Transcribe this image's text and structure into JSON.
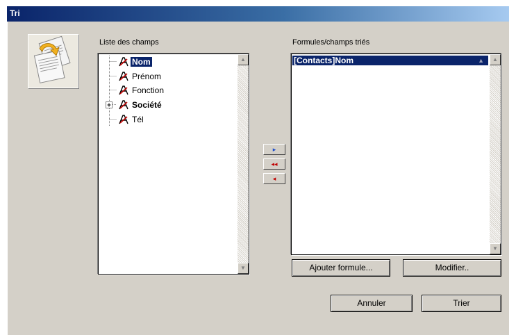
{
  "window": {
    "title": "Tri"
  },
  "icons": {
    "app": "sort-documents-icon",
    "field": "field-a-icon"
  },
  "left_panel": {
    "label": "Liste des champs",
    "items": [
      {
        "label": "Nom",
        "selected": true,
        "bold": true
      },
      {
        "label": "Prénom",
        "selected": false,
        "bold": false
      },
      {
        "label": "Fonction",
        "selected": false,
        "bold": false
      },
      {
        "label": "Société",
        "selected": false,
        "bold": true,
        "expandable": true
      },
      {
        "label": "Tél",
        "selected": false,
        "bold": false
      }
    ]
  },
  "right_panel": {
    "label": "Formules/champs triés",
    "items": [
      {
        "label": "[Contacts]Nom",
        "order": "ascending"
      }
    ]
  },
  "transfer_buttons": {
    "add": "▸",
    "remove_all": "◂◂",
    "remove": "◂"
  },
  "buttons": {
    "add_formula": "Ajouter formule...",
    "modify": "Modifier..",
    "cancel": "Annuler",
    "sort": "Trier"
  },
  "colors": {
    "selection": "#0a246a",
    "dialog_bg": "#d4d0c8",
    "arrow": "#c00000",
    "arrow_right": "#1a4bcc"
  }
}
